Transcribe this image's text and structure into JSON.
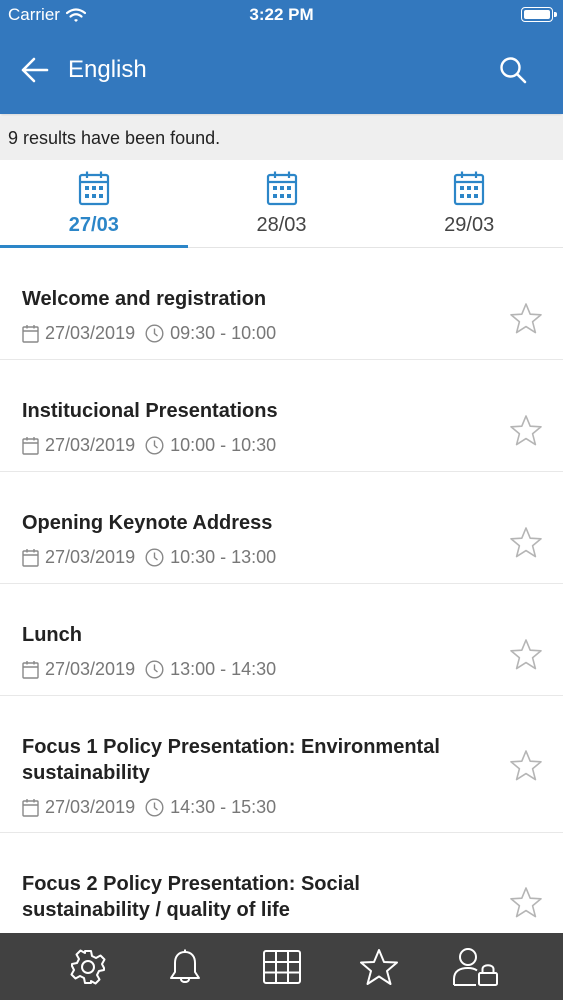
{
  "status_bar": {
    "carrier": "Carrier",
    "time": "3:22 PM",
    "wifi_icon": "wifi-icon",
    "battery_icon": "battery-icon"
  },
  "header": {
    "title": "English",
    "back_icon": "arrow-left-icon",
    "search_icon": "search-icon",
    "color": "#3378BE"
  },
  "results": {
    "text": "9 results have been found."
  },
  "date_tabs": [
    {
      "label": "27/03",
      "active": true
    },
    {
      "label": "28/03",
      "active": false
    },
    {
      "label": "29/03",
      "active": false
    }
  ],
  "accent_color": "#2C86C8",
  "events": [
    {
      "title": "Welcome and registration",
      "date": "27/03/2019",
      "time": "09:30 - 10:00"
    },
    {
      "title": "Institucional Presentations",
      "date": "27/03/2019",
      "time": "10:00 - 10:30"
    },
    {
      "title": "Opening Keynote Address",
      "date": "27/03/2019",
      "time": "10:30 - 13:00"
    },
    {
      "title": "Lunch",
      "date": "27/03/2019",
      "time": "13:00 - 14:30"
    },
    {
      "title": "Focus 1 Policy Presentation: Environmental sustainability",
      "date": "27/03/2019",
      "time": "14:30 - 15:30"
    },
    {
      "title": "Focus 2 Policy Presentation: Social sustainability / quality of life",
      "date": "",
      "time": ""
    }
  ],
  "tabbar": [
    {
      "icon": "gear-icon"
    },
    {
      "icon": "bell-icon"
    },
    {
      "icon": "grid-icon"
    },
    {
      "icon": "star-icon"
    },
    {
      "icon": "user-lock-icon"
    }
  ]
}
